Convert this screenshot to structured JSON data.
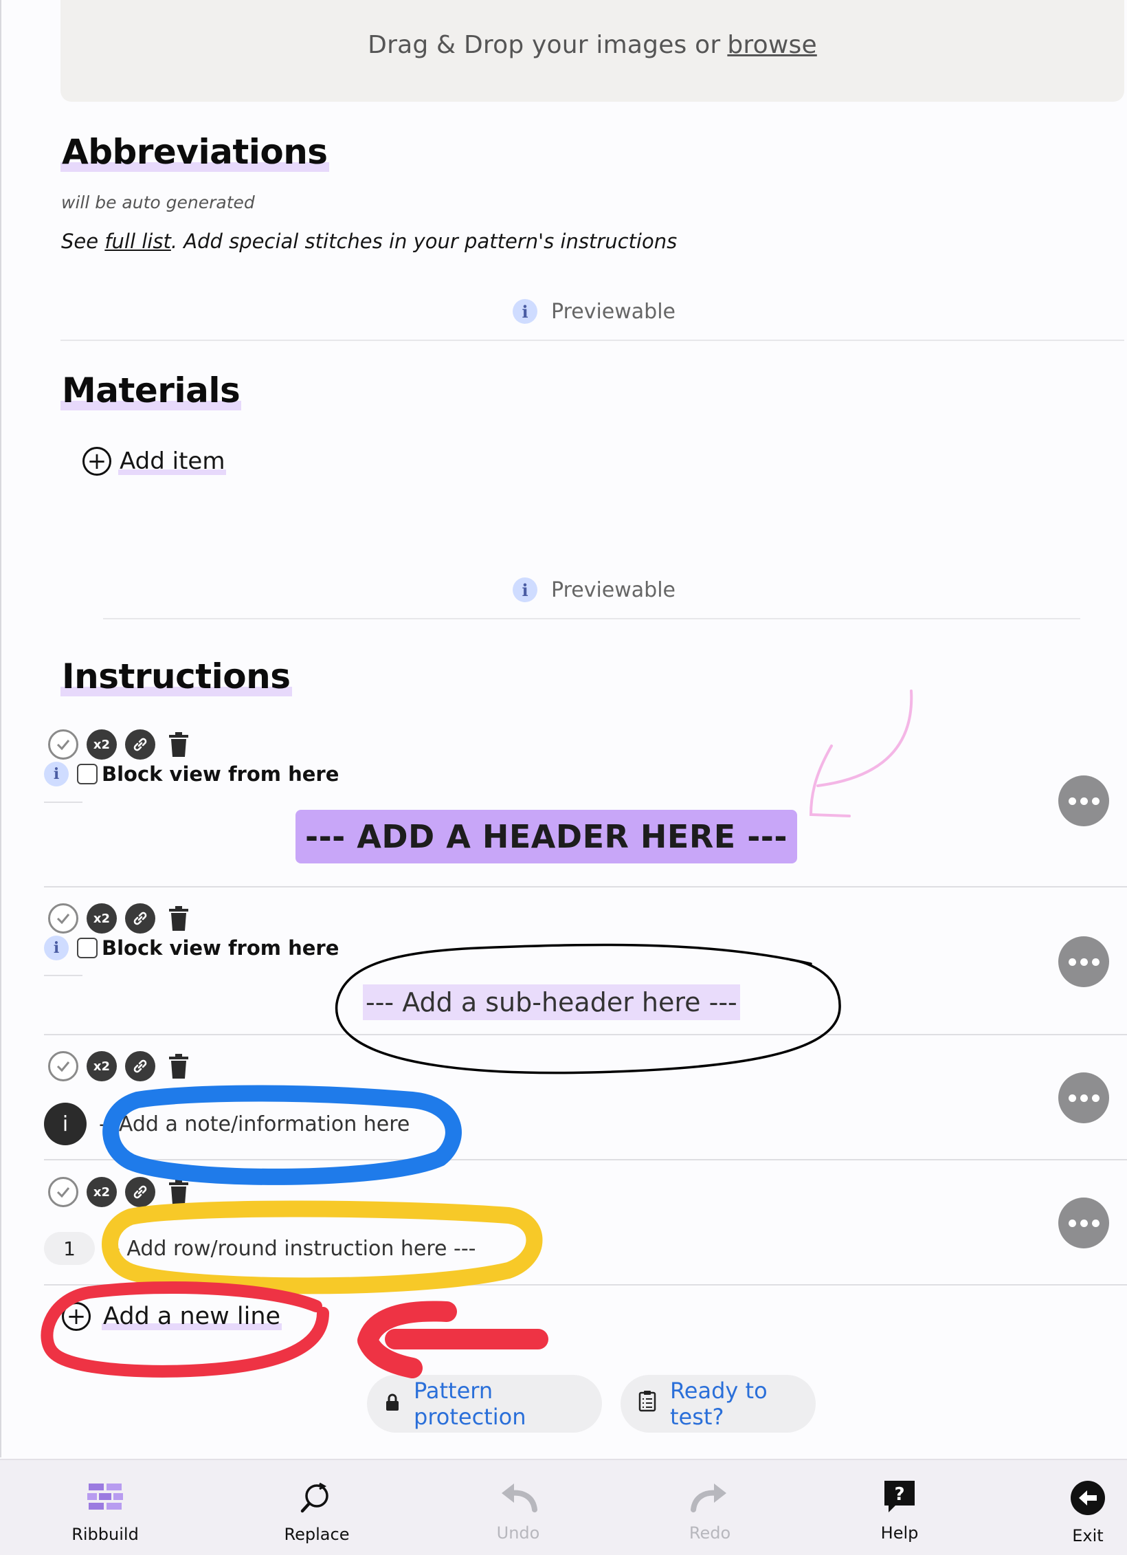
{
  "upload": {
    "prefix": "Drag & Drop your images or",
    "link": "browse"
  },
  "abbreviations": {
    "title": "Abbreviations",
    "note": "will be auto generated",
    "see_prefix": "See",
    "see_link": "full list",
    "see_suffix": ". Add special stitches in your pattern's instructions",
    "previewable": "Previewable"
  },
  "materials": {
    "title": "Materials",
    "add_item": "Add item",
    "previewable": "Previewable"
  },
  "instructions": {
    "title": "Instructions",
    "block_view_label": "Block view from here",
    "header_placeholder": "--- ADD A HEADER HERE ---",
    "subheader_placeholder": "--- Add a sub-header here ---",
    "note_dash": "-",
    "note_placeholder": "Add a note/information here",
    "row_number": "1",
    "row_placeholder": "- Add row/round instruction here ---",
    "add_line": "Add a new line",
    "tool_repeat": "x2"
  },
  "actions": {
    "pattern_protection": "Pattern protection",
    "ready_to_test": "Ready to test?"
  },
  "toolbar": [
    {
      "label": "Ribbuild",
      "icon": "bricks-icon",
      "enabled": true
    },
    {
      "label": "Replace",
      "icon": "replace-icon",
      "enabled": true
    },
    {
      "label": "Undo",
      "icon": "undo-icon",
      "enabled": false
    },
    {
      "label": "Redo",
      "icon": "redo-icon",
      "enabled": false
    },
    {
      "label": "Help",
      "icon": "help-icon",
      "enabled": true
    },
    {
      "label": "Exit",
      "icon": "exit-icon",
      "enabled": true
    }
  ],
  "colors": {
    "accent_purple": "#c8a6f8",
    "highlight_lavender": "#e7d9fb",
    "link_blue": "#2a6fd9",
    "annotation_blue": "#1f7bea",
    "annotation_yellow": "#f7c928",
    "annotation_red": "#ee3344",
    "annotation_pink": "#f4b6e6"
  }
}
